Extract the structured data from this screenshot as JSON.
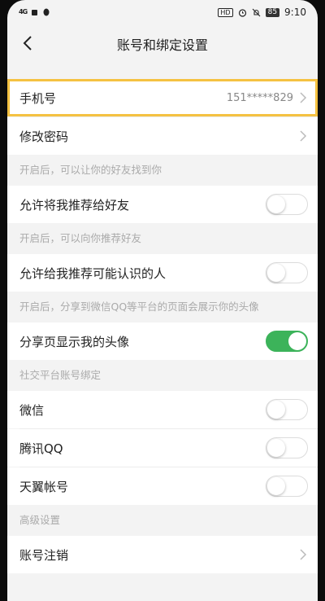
{
  "status_bar": {
    "signal": "4G",
    "battery": "85",
    "time": "9:10",
    "hd": "HD",
    "icons": [
      "signal-icon",
      "message-icon",
      "qq-penguin-icon",
      "hd-icon",
      "alarm-icon",
      "mute-icon",
      "battery-icon"
    ]
  },
  "header": {
    "title": "账号和绑定设置",
    "back_icon": "back-arrow-icon"
  },
  "rows": {
    "phone": {
      "label": "手机号",
      "value": "151*****829"
    },
    "password": {
      "label": "修改密码"
    },
    "section_friends": "开启后，可以让你的好友找到你",
    "recommend_me": {
      "label": "允许将我推荐给好友",
      "on": false
    },
    "section_recommend": "开启后，可以向你推荐好友",
    "recommend_people": {
      "label": "允许给我推荐可能认识的人",
      "on": false
    },
    "section_share": "开启后，分享到微信QQ等平台的页面会展示你的头像",
    "share_avatar": {
      "label": "分享页显示我的头像",
      "on": true
    },
    "section_social": "社交平台账号绑定",
    "wechat": {
      "label": "微信",
      "on": false
    },
    "qq": {
      "label": "腾讯QQ",
      "on": false
    },
    "tianyi": {
      "label": "天翼帐号",
      "on": false
    },
    "section_advanced": "高级设置",
    "cancel_account": {
      "label": "账号注销"
    }
  },
  "colors": {
    "accent_on": "#3cb35a",
    "highlight": "#f5c242"
  }
}
